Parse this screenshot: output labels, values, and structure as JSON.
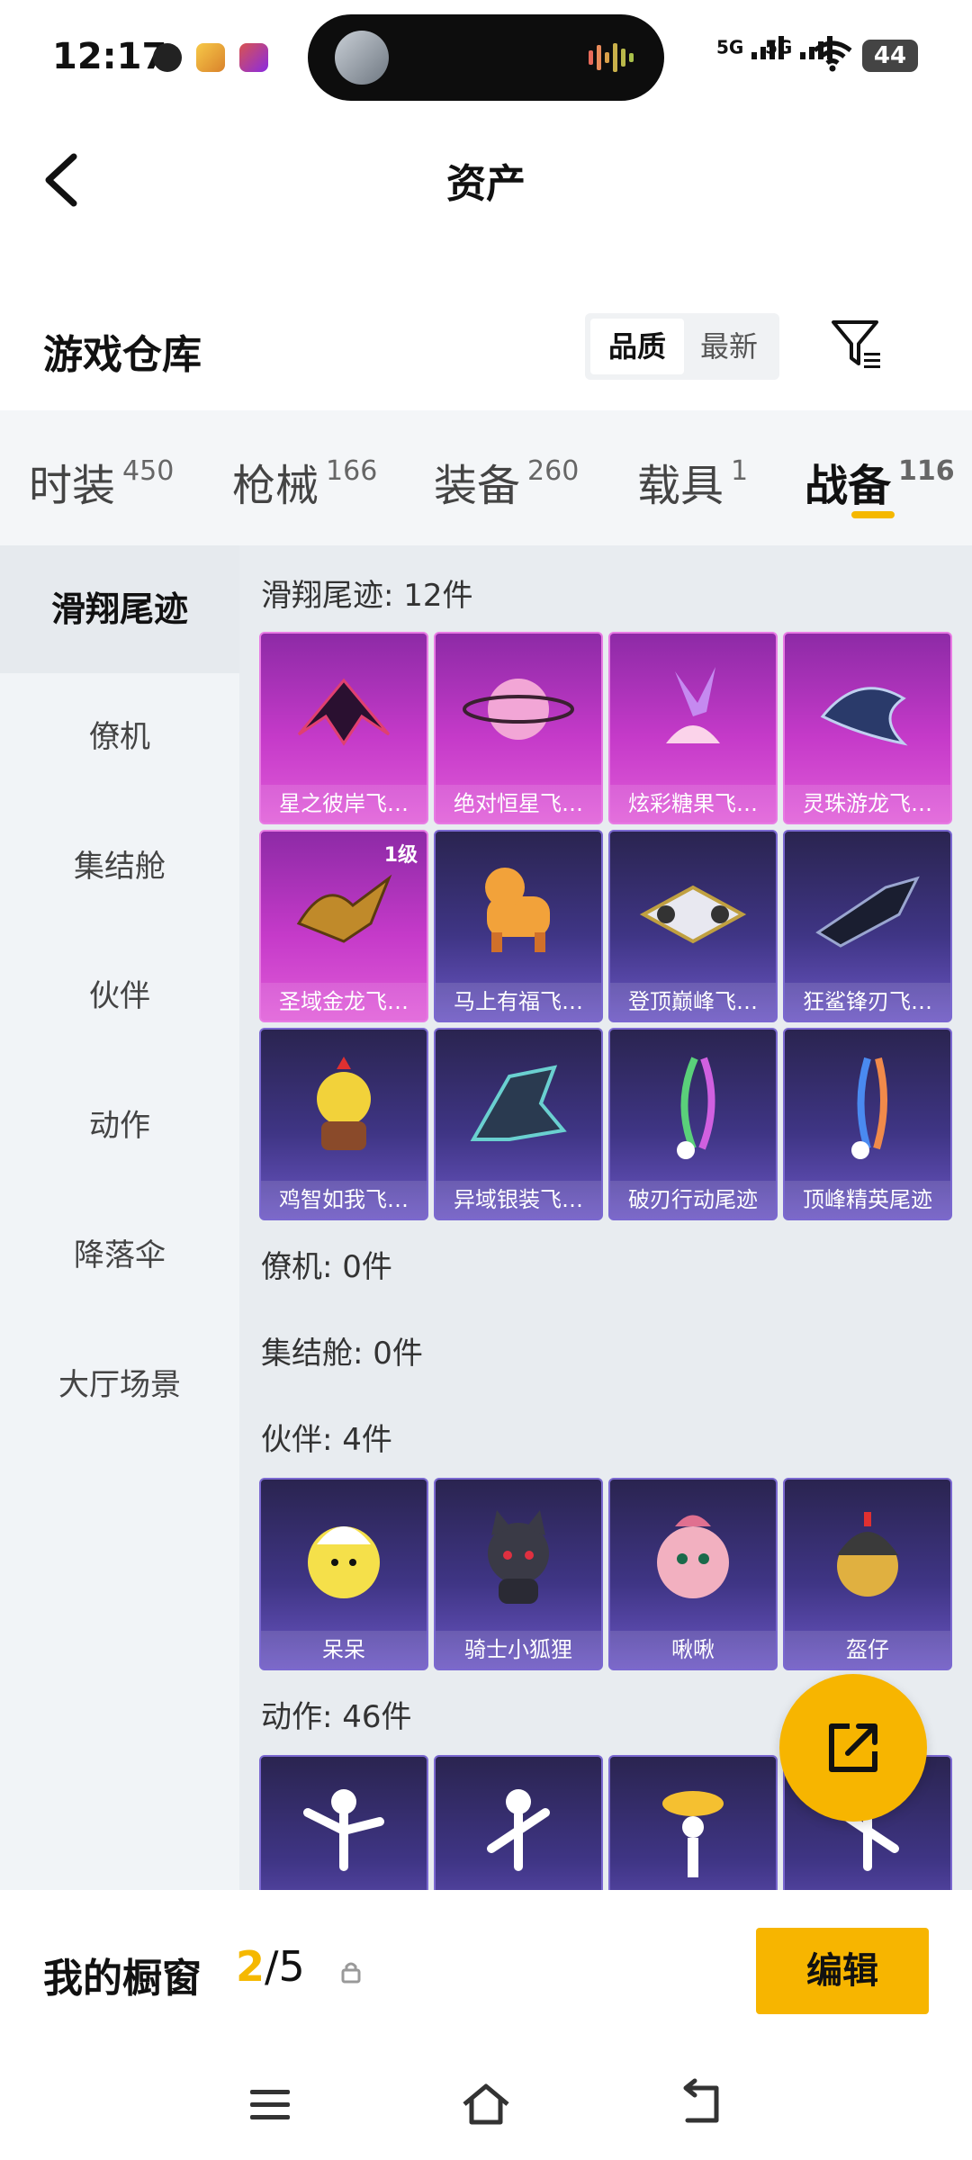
{
  "status_bar": {
    "time": "12:17",
    "signal_1": "5G",
    "signal_2": "5G",
    "battery": "44"
  },
  "header": {
    "title": "资产"
  },
  "warehouse": {
    "title": "游戏仓库",
    "sort_options": [
      "品质",
      "最新"
    ],
    "sort_selected": "品质"
  },
  "tabs": [
    {
      "label": "时装",
      "count": "450"
    },
    {
      "label": "枪械",
      "count": "166"
    },
    {
      "label": "装备",
      "count": "260"
    },
    {
      "label": "载具",
      "count": "1"
    },
    {
      "label": "战备",
      "count": "116"
    }
  ],
  "sidebar": {
    "items": [
      "滑翔尾迹",
      "僚机",
      "集结舱",
      "伙伴",
      "动作",
      "降落伞",
      "大厅场景"
    ],
    "active": "滑翔尾迹"
  },
  "sections": {
    "glide": {
      "header": "滑翔尾迹: 12件",
      "items": [
        {
          "name": "星之彼岸飞…",
          "quality": "purple"
        },
        {
          "name": "绝对恒星飞…",
          "quality": "purple"
        },
        {
          "name": "炫彩糖果飞…",
          "quality": "purple"
        },
        {
          "name": "灵珠游龙飞…",
          "quality": "purple"
        },
        {
          "name": "圣域金龙飞…",
          "quality": "purple",
          "level": "1级"
        },
        {
          "name": "马上有福飞…",
          "quality": "blue"
        },
        {
          "name": "登顶巅峰飞…",
          "quality": "blue"
        },
        {
          "name": "狂鲨锋刃飞…",
          "quality": "blue"
        },
        {
          "name": "鸡智如我飞…",
          "quality": "blue"
        },
        {
          "name": "异域银装飞…",
          "quality": "blue"
        },
        {
          "name": "破刃行动尾迹",
          "quality": "blue"
        },
        {
          "name": "顶峰精英尾迹",
          "quality": "blue"
        }
      ]
    },
    "wingman": {
      "header": "僚机: 0件"
    },
    "pod": {
      "header": "集结舱: 0件"
    },
    "partner": {
      "header": "伙伴: 4件",
      "items": [
        {
          "name": "呆呆",
          "quality": "blue"
        },
        {
          "name": "骑士小狐狸",
          "quality": "blue"
        },
        {
          "name": "啾啾",
          "quality": "blue"
        },
        {
          "name": "盔仔",
          "quality": "blue"
        }
      ]
    },
    "emote": {
      "header": "动作: 46件"
    }
  },
  "showcase": {
    "title": "我的橱窗",
    "current": "2",
    "total": "/5",
    "edit_label": "编辑"
  },
  "colors": {
    "accent": "#f7b500",
    "purple_card": "#c53ac9",
    "blue_card": "#3f3585"
  }
}
